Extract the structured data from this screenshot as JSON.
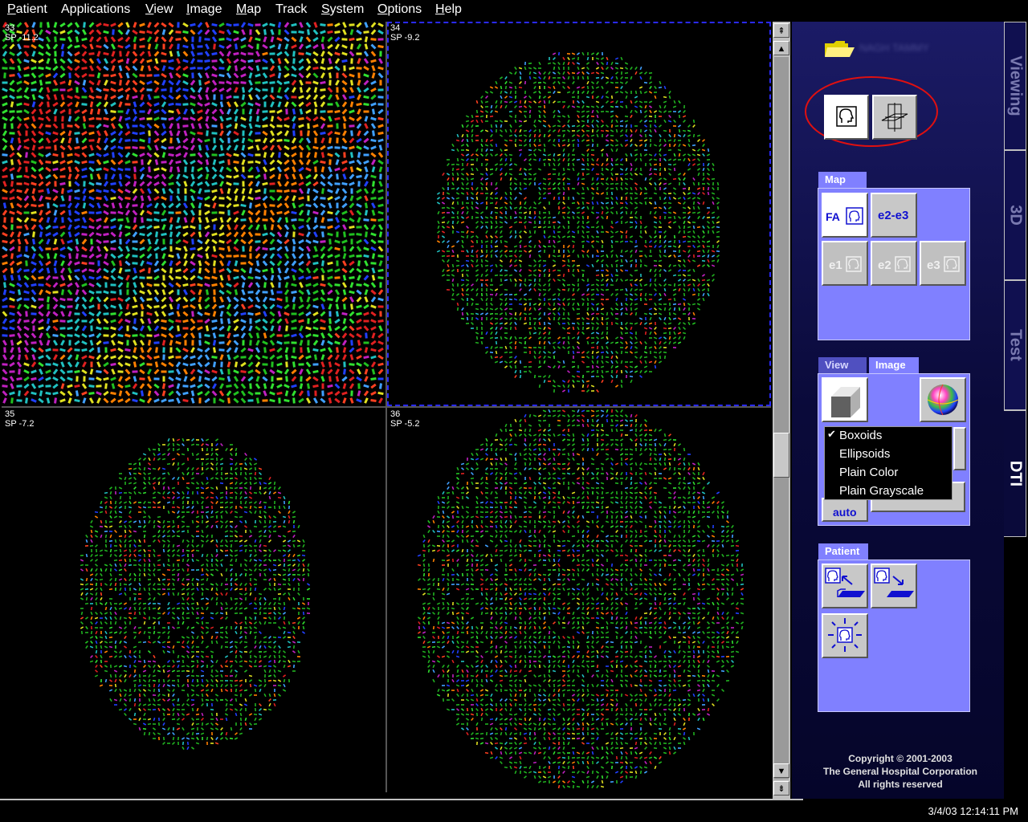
{
  "menu": {
    "items": [
      {
        "label": "Patient",
        "underline": "P",
        "rest": "atient"
      },
      {
        "label": "Applications",
        "underline": "",
        "rest": "Applications"
      },
      {
        "label": "View",
        "underline": "V",
        "rest": "iew"
      },
      {
        "label": "Image",
        "underline": "I",
        "rest": "mage"
      },
      {
        "label": "Map",
        "underline": "M",
        "rest": "ap"
      },
      {
        "label": "Track",
        "underline": "",
        "rest": "Track"
      },
      {
        "label": "System",
        "underline": "S",
        "rest": "ystem"
      },
      {
        "label": "Options",
        "underline": "O",
        "rest": "ptions"
      },
      {
        "label": "Help",
        "underline": "H",
        "rest": "elp"
      }
    ]
  },
  "viewports": [
    {
      "index": "33",
      "position": "SP -11.2"
    },
    {
      "index": "34",
      "position": "SP -9.2"
    },
    {
      "index": "35",
      "position": "SP -7.2"
    },
    {
      "index": "36",
      "position": "SP -5.2"
    }
  ],
  "side_tabs": [
    "Viewing",
    "3D",
    "Test",
    "DTI"
  ],
  "active_tab": "DTI",
  "patient_name": "NAGH TAMMY",
  "map_group": {
    "title": "Map",
    "buttons": [
      {
        "label": "FA",
        "enabled": true
      },
      {
        "label": "e2-e3",
        "enabled": true
      },
      {
        "label": "e1",
        "enabled": false
      },
      {
        "label": "e2",
        "enabled": false
      },
      {
        "label": "e3",
        "enabled": false
      }
    ]
  },
  "view_group": {
    "tabs": [
      "View",
      "Image"
    ],
    "active_tab": "Image",
    "auto_label": "auto",
    "dropdown": {
      "selected": "Boxoids",
      "options": [
        "Boxoids",
        "Ellipsoids",
        "Plain Color",
        "Plain Grayscale"
      ]
    }
  },
  "patient_group": {
    "title": "Patient"
  },
  "copyright": {
    "line1": "Copyright © 2001-2003",
    "line2": "The General Hospital Corporation",
    "line3": "All rights reserved"
  },
  "clock": "3/4/03 12:14:11 PM",
  "colors": {
    "panel_bg": "#0a0a3a",
    "group_bg": "#8080ff",
    "highlight_circle": "#e01010",
    "active_viewport_border": "#2a2aff"
  }
}
